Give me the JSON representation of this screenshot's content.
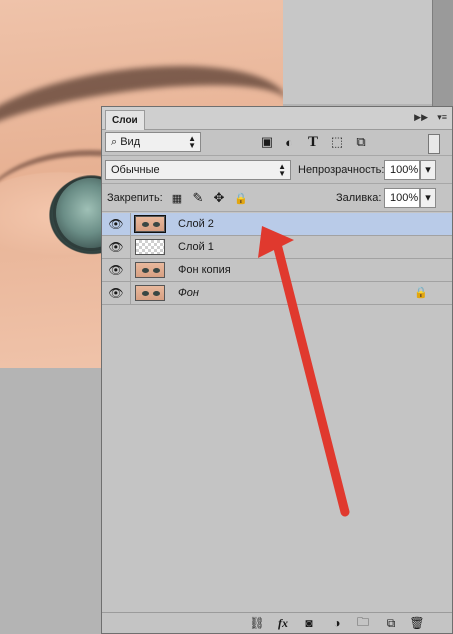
{
  "panel": {
    "tab_label": "Слои",
    "collapse_icon": "double-chevron-right-icon",
    "menu_icon": "panel-menu-icon"
  },
  "filter": {
    "kind_label": "Вид",
    "icons": [
      "pixel-filter-icon",
      "adjustment-filter-icon",
      "type-filter-icon",
      "shape-filter-icon",
      "smart-object-filter-icon"
    ]
  },
  "blend": {
    "mode": "Обычные",
    "opacity_label": "Непрозрачность:",
    "opacity_value": "100%"
  },
  "lock": {
    "label": "Закрепить:",
    "fill_label": "Заливка:",
    "fill_value": "100%"
  },
  "layers": [
    {
      "name": "Слой 2",
      "selected": true,
      "thumb": "photo"
    },
    {
      "name": "Слой 1",
      "selected": false,
      "thumb": "transparent"
    },
    {
      "name": "Фон копия",
      "selected": false,
      "thumb": "photo"
    },
    {
      "name": "Фон",
      "selected": false,
      "thumb": "photo",
      "locked": true
    }
  ],
  "bottom_icons": [
    "link-layers-icon",
    "fx-icon",
    "add-mask-icon",
    "adjustment-layer-icon",
    "new-group-icon",
    "new-layer-icon",
    "delete-layer-icon"
  ],
  "fx_label": "fx",
  "colors": {
    "selection": "#b9cbe8",
    "arrow": "#e0392e",
    "panel": "#c4c4c4"
  }
}
